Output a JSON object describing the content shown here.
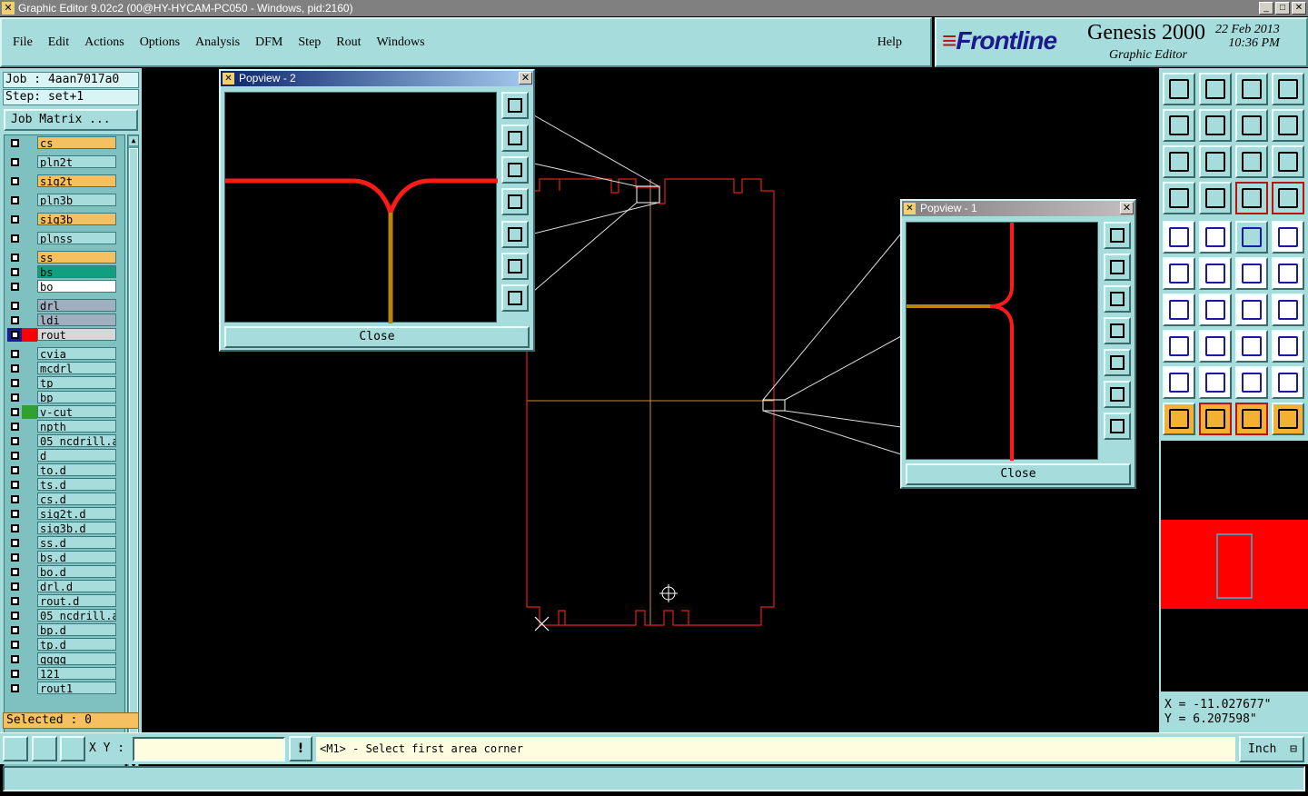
{
  "window": {
    "title": "Graphic Editor 9.02c2 (00@HY-HYCAM-PC050 - Windows, pid:2160)"
  },
  "menu": {
    "items": [
      "File",
      "Edit",
      "Actions",
      "Options",
      "Analysis",
      "DFM",
      "Step",
      "Rout",
      "Windows"
    ],
    "help": "Help"
  },
  "brand": {
    "logo": "Frontline",
    "product": "Genesis 2000",
    "subtitle": "Graphic Editor",
    "date": "22 Feb 2013",
    "time": "10:36 PM"
  },
  "job": {
    "job": "Job : 4aan7017a0",
    "step": "Step: set+1",
    "matrix_button": "Job Matrix ..."
  },
  "layers": [
    {
      "name": "cs",
      "color": "#f4c060"
    },
    {
      "name": "pln2t",
      "color": "#a6dcdc"
    },
    {
      "name": "sig2t",
      "color": "#f4c060"
    },
    {
      "name": "pln3b",
      "color": "#a6dcdc"
    },
    {
      "name": "sig3b",
      "color": "#f4c060"
    },
    {
      "name": "plnss",
      "color": "#a6dcdc"
    },
    {
      "name": "ss",
      "color": "#f4c060"
    },
    {
      "name": "bs",
      "color": "#10a080"
    },
    {
      "name": "bo",
      "color": "#ffffff"
    },
    {
      "name": "drl",
      "color": "#a0b0c0"
    },
    {
      "name": "ldi",
      "color": "#a0b0c0"
    },
    {
      "name": "rout",
      "color": "#d8d8d8"
    },
    {
      "name": "cvia",
      "color": "#a6dcdc"
    },
    {
      "name": "mcdrl",
      "color": "#a6dcdc"
    },
    {
      "name": "tp",
      "color": "#a6dcdc"
    },
    {
      "name": "bp",
      "color": "#a6dcdc"
    },
    {
      "name": "v-cut",
      "color": "#a6dcdc"
    },
    {
      "name": "npth",
      "color": "#a6dcdc"
    },
    {
      "name": "05_ncdrill.a",
      "color": "#a6dcdc"
    },
    {
      "name": "d",
      "color": "#a6dcdc"
    },
    {
      "name": "to.d",
      "color": "#a6dcdc"
    },
    {
      "name": "ts.d",
      "color": "#a6dcdc"
    },
    {
      "name": "cs.d",
      "color": "#a6dcdc"
    },
    {
      "name": "sig2t.d",
      "color": "#a6dcdc"
    },
    {
      "name": "sig3b.d",
      "color": "#a6dcdc"
    },
    {
      "name": "ss.d",
      "color": "#a6dcdc"
    },
    {
      "name": "bs.d",
      "color": "#a6dcdc"
    },
    {
      "name": "bo.d",
      "color": "#a6dcdc"
    },
    {
      "name": "drl.d",
      "color": "#a6dcdc"
    },
    {
      "name": "rout.d",
      "color": "#a6dcdc"
    },
    {
      "name": "05_ncdrill.a",
      "color": "#a6dcdc"
    },
    {
      "name": "bp.d",
      "color": "#a6dcdc"
    },
    {
      "name": "tp.d",
      "color": "#a6dcdc"
    },
    {
      "name": "qqqq",
      "color": "#a6dcdc"
    },
    {
      "name": "121",
      "color": "#a6dcdc"
    },
    {
      "name": "rout1",
      "color": "#a6dcdc"
    }
  ],
  "selected": "Selected : 0",
  "popview2": {
    "title": "Popview - 2",
    "close": "Close"
  },
  "popview1": {
    "title": "Popview - 1",
    "close": "Close"
  },
  "coords": {
    "x": "X = -11.027677\"",
    "y": "Y =  6.207598\""
  },
  "bottom": {
    "xy_label": "X Y :",
    "xy_value": "",
    "message": "<M1> - Select first area corner",
    "unit": "Inch"
  },
  "colors": {
    "panel": "#a6dcdc",
    "trace": "#ff1a1a",
    "route": "#b8860b",
    "outline": "#e02020"
  }
}
